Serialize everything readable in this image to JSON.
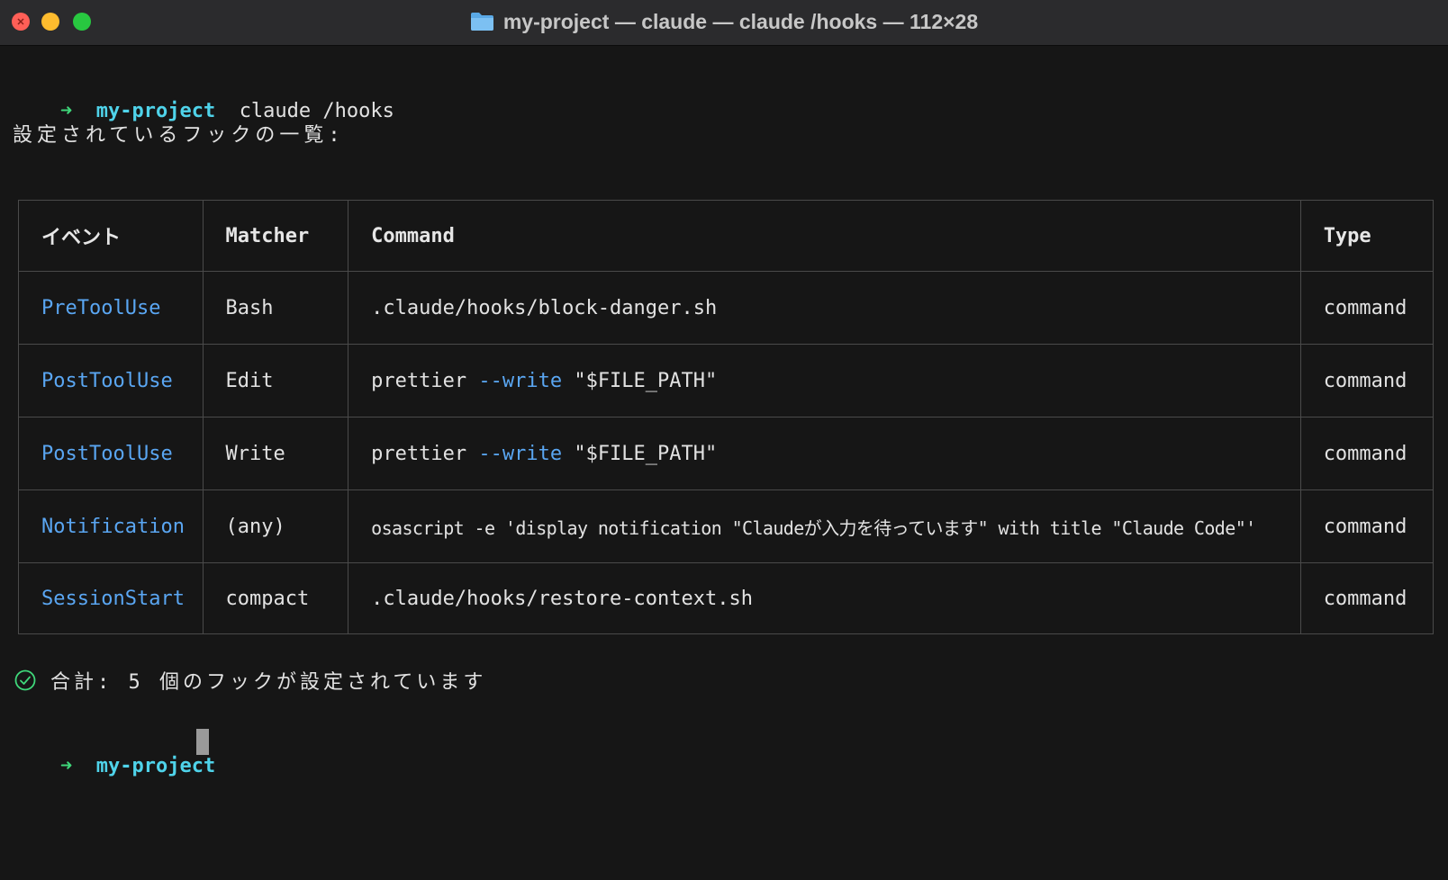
{
  "window": {
    "title": "my-project — claude — claude /hooks — 112×28"
  },
  "terminal": {
    "prompt_arrow": "➜",
    "prompt_dir": "my-project",
    "command": "claude /hooks",
    "heading": "設定されているフックの一覧:",
    "summary": "合計: 5 個のフックが設定されています",
    "cursor_visible": true
  },
  "table": {
    "headers": [
      "イベント",
      "Matcher",
      "Command",
      "Type"
    ],
    "rows": [
      {
        "event": "PreToolUse",
        "matcher": "Bash",
        "cmd_pre": ".claude/hooks/block-danger.sh",
        "cmd_flag": "",
        "cmd_post": "",
        "type": "command"
      },
      {
        "event": "PostToolUse",
        "matcher": "Edit",
        "cmd_pre": "prettier ",
        "cmd_flag": "--write",
        "cmd_post": " \"$FILE_PATH\"",
        "type": "command"
      },
      {
        "event": "PostToolUse",
        "matcher": "Write",
        "cmd_pre": "prettier ",
        "cmd_flag": "--write",
        "cmd_post": " \"$FILE_PATH\"",
        "type": "command"
      },
      {
        "event": "Notification",
        "matcher": "(any)",
        "cmd_pre": "osascript -e 'display notification \"Claudeが入力を待っています\" with title \"Claude Code\"'",
        "cmd_flag": "",
        "cmd_post": "",
        "type": "command"
      },
      {
        "event": "SessionStart",
        "matcher": "compact",
        "cmd_pre": ".claude/hooks/restore-context.sh",
        "cmd_flag": "",
        "cmd_post": "",
        "type": "command"
      }
    ]
  },
  "colors": {
    "background": "#161616",
    "prompt_arrow": "#3fd77a",
    "prompt_dir": "#4fd3ea",
    "event_name": "#5aa6f2",
    "flag": "#5aa6f2",
    "success": "#3fd77a"
  },
  "icons": {
    "folder": "folder-icon",
    "check": "check-circle-icon"
  }
}
